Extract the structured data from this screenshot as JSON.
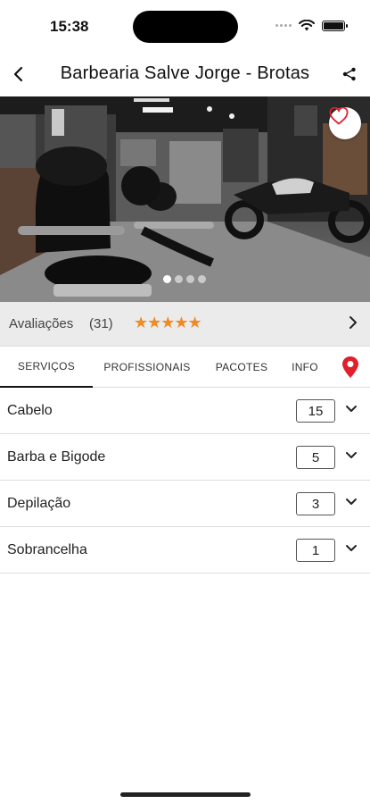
{
  "status_bar": {
    "time": "15:38"
  },
  "header": {
    "title": "Barbearia Salve Jorge - Brotas"
  },
  "reviews": {
    "label": "Avaliações",
    "count": "(31)",
    "stars": "★★★★★",
    "rating": 5
  },
  "tabs": [
    {
      "label": "SERVIÇOS",
      "active": true
    },
    {
      "label": "PROFISSIONAIS"
    },
    {
      "label": "PACOTES"
    },
    {
      "label": "INFO"
    }
  ],
  "services": [
    {
      "name": "Cabelo",
      "count": "15"
    },
    {
      "name": "Barba e Bigode",
      "count": "5"
    },
    {
      "name": "Depilação",
      "count": "3"
    },
    {
      "name": "Sobrancelha",
      "count": "1"
    }
  ],
  "carousel": {
    "total": 4,
    "active_index": 0
  },
  "colors": {
    "accent": "#f08a24",
    "location_pin": "#e0202b",
    "reviews_bg": "#ebebeb"
  },
  "icons": {
    "back": "chevron-left-icon",
    "share": "share-icon",
    "favorite": "heart-outline-icon",
    "reviews_arrow": "chevron-right-icon",
    "location": "location-pin-icon",
    "expand": "chevron-down-icon"
  }
}
